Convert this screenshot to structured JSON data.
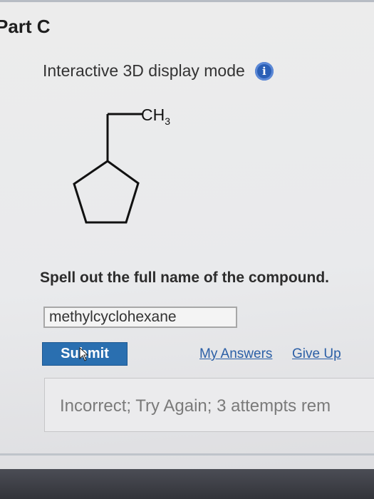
{
  "part": {
    "title": "Part C"
  },
  "display_mode": {
    "label": "Interactive 3D display mode",
    "info_icon": "info-icon",
    "info_glyph": "i"
  },
  "structure": {
    "substituent_label": "CH",
    "substituent_subscript": "3"
  },
  "question": {
    "prompt": "Spell out the full name of the compound."
  },
  "answer": {
    "value": "methylcyclohexane",
    "placeholder": ""
  },
  "actions": {
    "submit_label": "Submit",
    "my_answers_label": "My Answers",
    "give_up_label": "Give Up"
  },
  "feedback": {
    "text": "Incorrect; Try Again; 3 attempts rem"
  },
  "colors": {
    "accent": "#2a6fb0",
    "link": "#2b5fa6",
    "info_icon": "#2a5fb6"
  }
}
